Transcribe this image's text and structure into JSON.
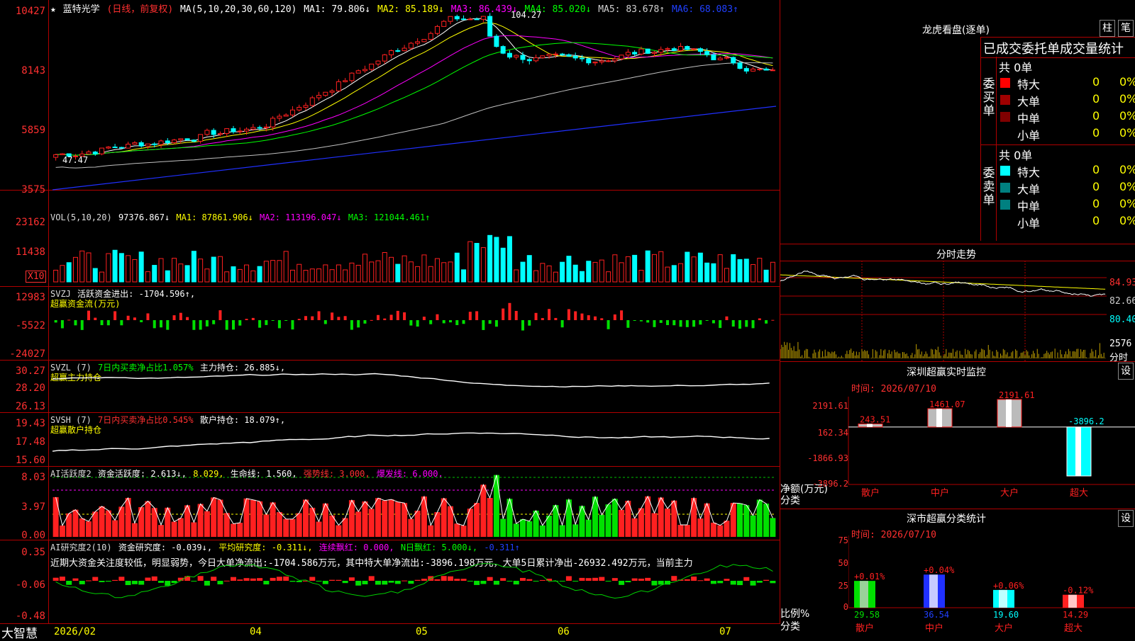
{
  "stock": {
    "title_char": "★",
    "name": "蓝特光学",
    "mode": "(日线，前复权)",
    "marker": "+"
  },
  "price_header": {
    "ma_def": "MA(5,10,20,30,60,120)",
    "ma1": "MA1: 79.806↓",
    "ma2": "MA2: 85.189↓",
    "ma3": "MA3: 86.439↓",
    "ma4": "MA4: 85.020↓",
    "ma5": "MA5: 83.678↑",
    "ma6": "MA6: 68.083↑"
  },
  "price_axis": [
    "10427",
    "8143",
    "5859",
    "3575"
  ],
  "price_marks": {
    "high": "104.27",
    "low": "47.47"
  },
  "vol_header": {
    "def": "VOL(5,10,20)",
    "v": "97376.867↓",
    "ma1": "MA1: 87861.906↓",
    "ma2": "MA2: 113196.047↓",
    "ma3": "MA3: 121044.461↑"
  },
  "vol_axis": [
    "23162",
    "11438"
  ],
  "vol_unit": "X10",
  "svzj": {
    "name": "SVZJ",
    "text": "活跃资金进出: -1704.596↑,",
    "sub": "超赢资金流(万元)",
    "axis": [
      "12983",
      "-5522",
      "-24027"
    ]
  },
  "svzl": {
    "name": "SVZL (7)",
    "ratio": "7日内买卖净占比1.057%",
    "hold": "主力持仓: 26.885↓,",
    "sub": "超赢主力持仓",
    "axis": [
      "30.27",
      "28.20",
      "26.13"
    ]
  },
  "svsh": {
    "name": "SVSH (7)",
    "ratio": "7日内买卖净占比0.545%",
    "hold": "散户持仓: 18.079↑,",
    "sub": "超赢散户持仓",
    "axis": [
      "19.43",
      "17.48",
      "15.60"
    ]
  },
  "ai1": {
    "name": "AI活跃度2",
    "v1": "资金活跃度: 2.613↓,",
    "v2": "8.029,",
    "v3": "生命线: 1.560,",
    "v4": "强势线: 3.000,",
    "v5": "爆发线: 6.000,",
    "axis": [
      "8.03",
      "3.97",
      "0.00"
    ]
  },
  "ai2": {
    "name": "AI研究度2(10)",
    "v1": "资金研究度: -0.039↓,",
    "v2": "平均研究度: -0.311↓,",
    "v3": "连续飘红: 0.000,",
    "v4": "N日飘红: 5.000↓,",
    "v5": "-0.311↑",
    "axis": [
      "0.35",
      "-0.06",
      "-0.48"
    ],
    "note": "近期大资金关注度较低，明显弱势，今日大单净流出:-1704.586万元，其中特大单净流出:-3896.198万元，大单5日累计净出-26932.492万元，当前主力"
  },
  "bottom": {
    "brand": "大智慧",
    "dates": [
      "2026/02",
      "04",
      "05",
      "06",
      "07"
    ]
  },
  "lhb": {
    "title": "龙虎看盘(逐单)",
    "btn1": "柱",
    "btn2": "笔",
    "tab": "已成交委托单成交量统计",
    "buy_label": "委买单",
    "sell_label": "委卖单",
    "buy_total": "共 0单",
    "sell_total": "共 0单",
    "rows": [
      {
        "k": "特大",
        "n": "0",
        "p": "0%"
      },
      {
        "k": "大单",
        "n": "0",
        "p": "0%"
      },
      {
        "k": "中单",
        "n": "0",
        "p": "0%"
      },
      {
        "k": "小单",
        "n": "0",
        "p": "0%"
      }
    ]
  },
  "fenshi": {
    "title": "分时走势",
    "axis": [
      "84.93",
      "82.66",
      "80.40"
    ],
    "vol": "2576",
    "vol_unit": "分时"
  },
  "sz_monitor": {
    "title": "深圳超赢实时监控",
    "btn": "设",
    "time": "时间: 2026/07/10",
    "axis": [
      "2191.61",
      "162.34",
      "-1866.93",
      "-3896.2"
    ],
    "ylabel": "净额(万元)",
    "xlabel": "分类",
    "cats": [
      "散户",
      "中户",
      "大户",
      "超大"
    ],
    "values": [
      243.51,
      1461.07,
      2191.61,
      -3896.2
    ],
    "labels": [
      "243.51",
      "1461.07",
      "2191.61",
      "-3896.2"
    ]
  },
  "sz_class": {
    "title": "深市超赢分类统计",
    "btn": "设",
    "time": "时间: 2026/07/10",
    "axis": [
      "75",
      "50",
      "25",
      "0"
    ],
    "ylabel": "比例%",
    "xlabel": "分类",
    "cats": [
      "散户",
      "中户",
      "大户",
      "超大"
    ],
    "values": [
      29.58,
      36.54,
      19.6,
      14.29
    ],
    "labels": [
      "29.58",
      "36.54",
      "19.60",
      "14.29"
    ],
    "changes": [
      "+0.01%",
      "+0.04%",
      "+0.06%",
      "-0.12%"
    ]
  },
  "colors": {
    "up": "#ff2020",
    "down": "#00ffff",
    "green": "#00e000",
    "yellow": "#ffff00",
    "magenta": "#ff00ff",
    "grid": "#b00000"
  }
}
